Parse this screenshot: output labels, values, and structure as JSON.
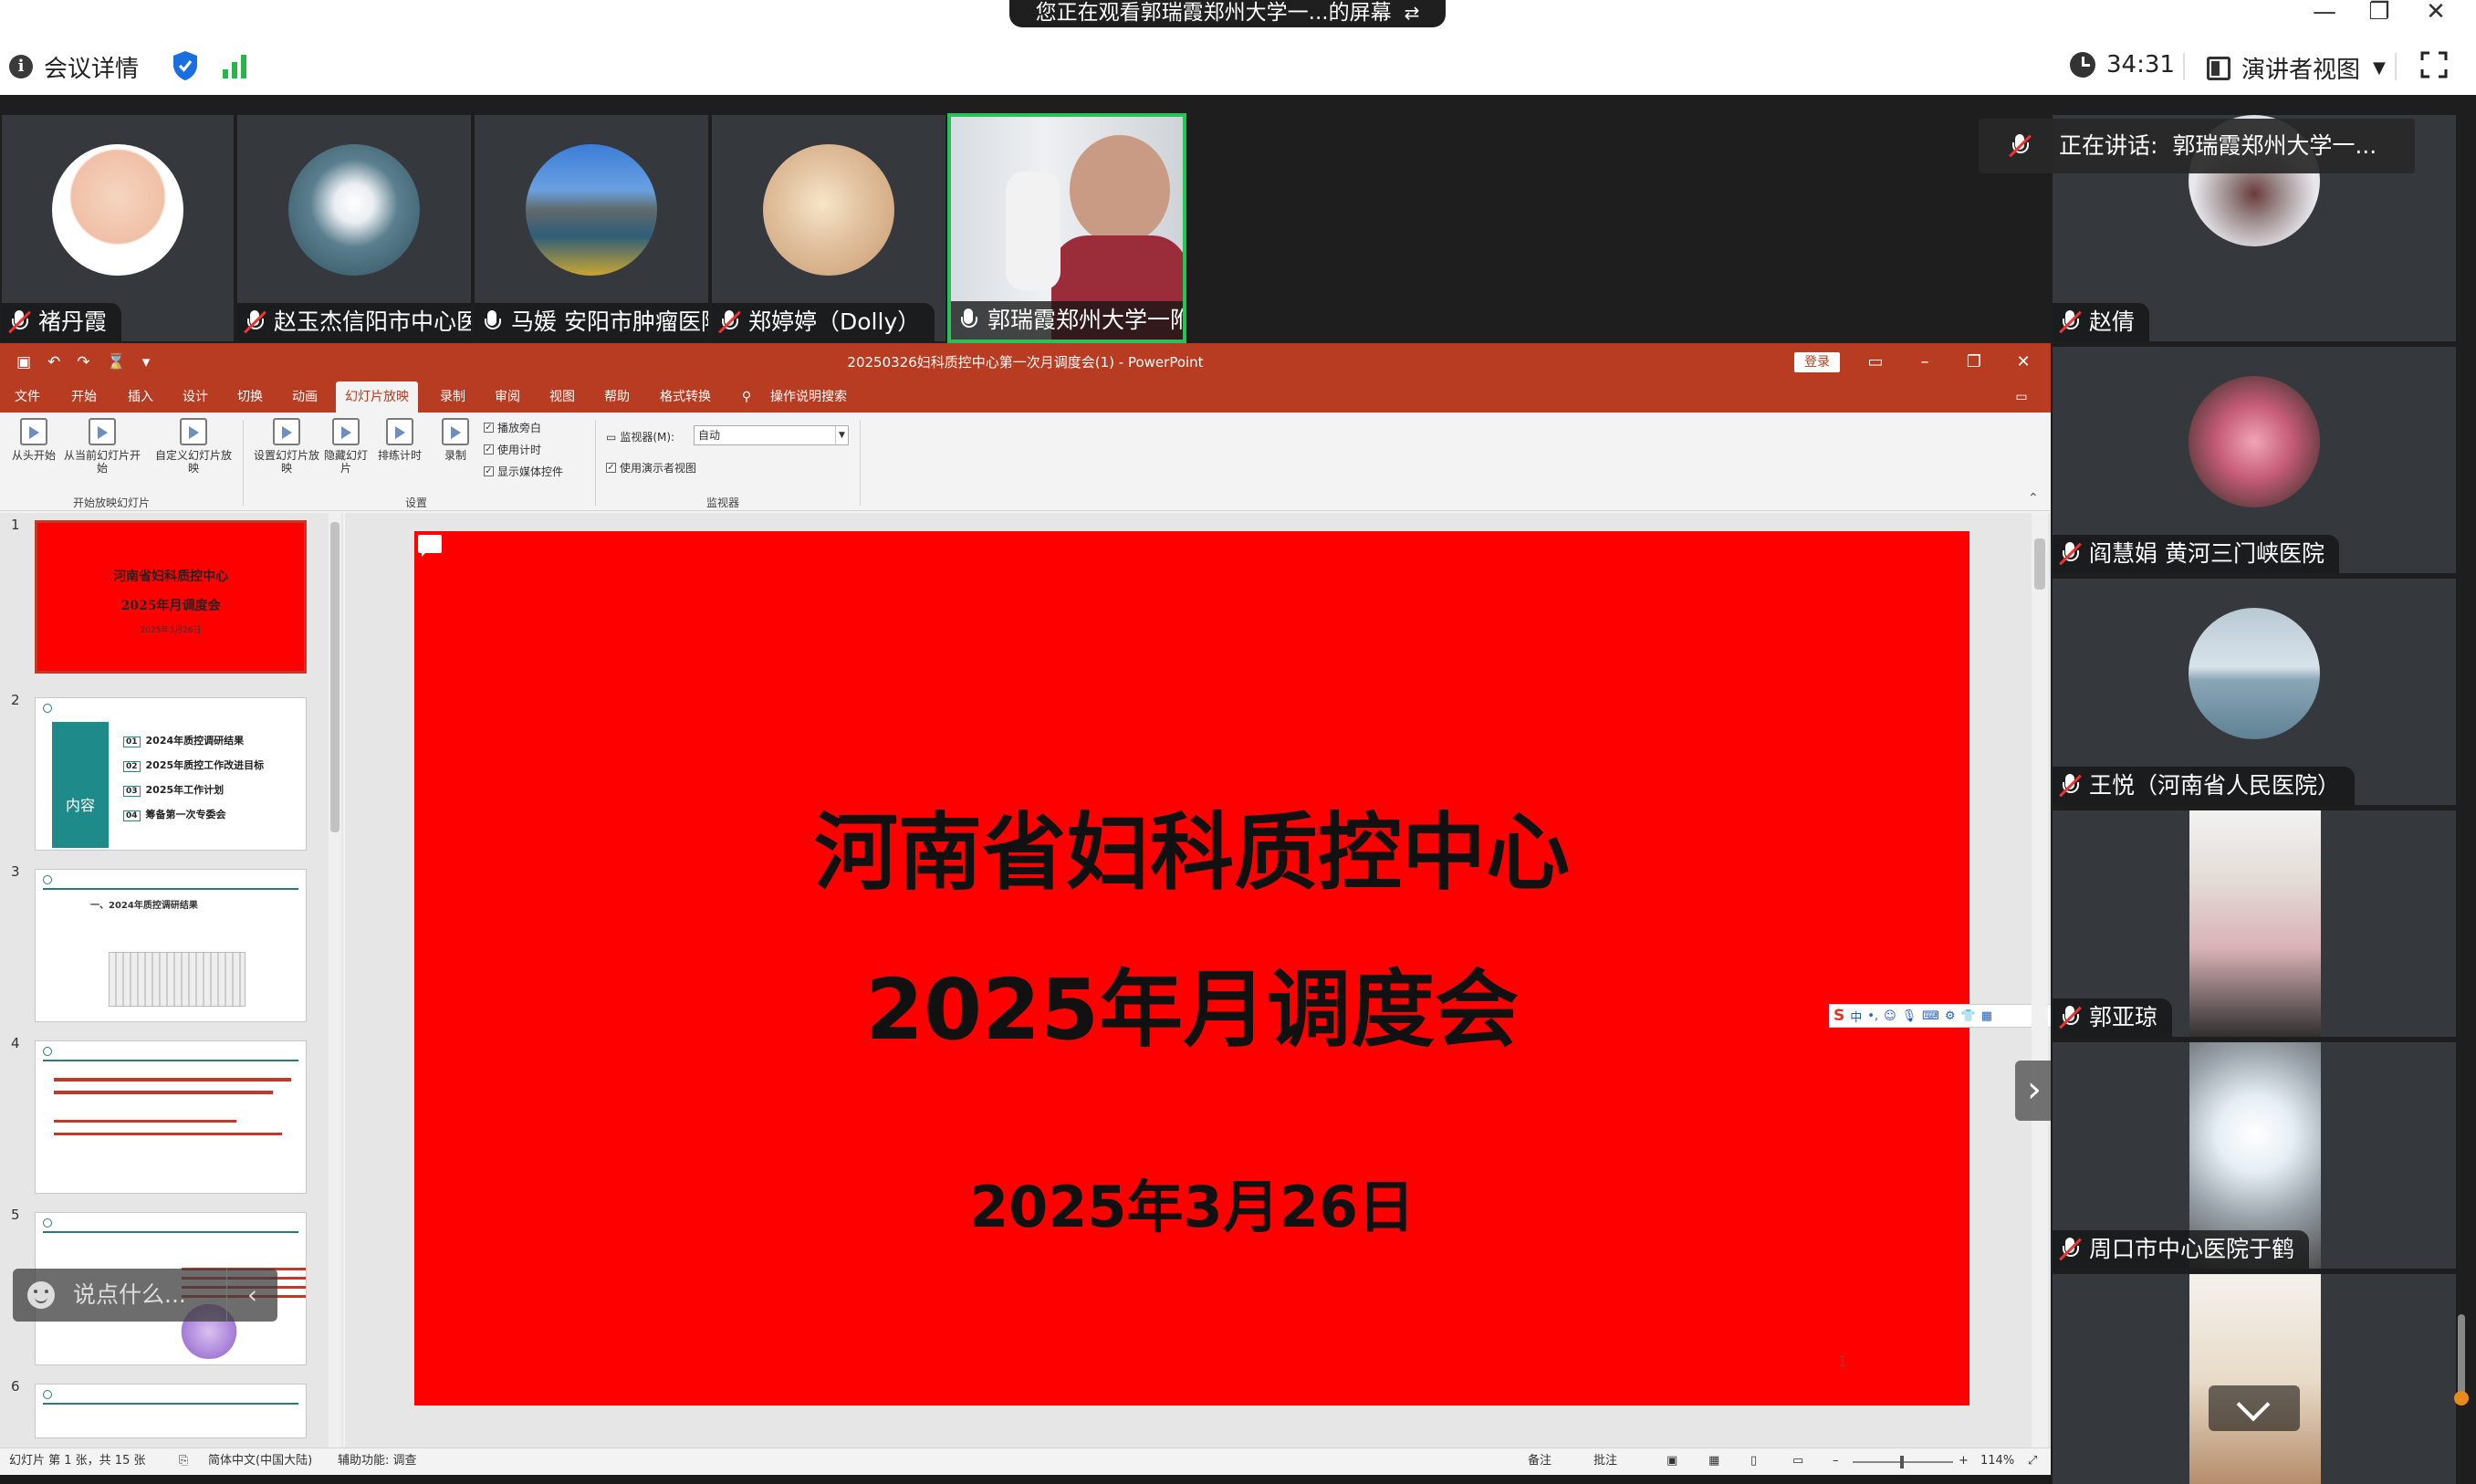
{
  "window": {
    "share_banner": "您正在观看郭瑞霞郑州大学一...的屏幕",
    "meeting_info_label": "会议详情",
    "timer": "34:31",
    "view_mode_label": "演讲者视图"
  },
  "speaking": {
    "label": "正在讲话:",
    "name": "郭瑞霞郑州大学一..."
  },
  "top_participants": [
    {
      "name": "褚丹霞"
    },
    {
      "name": "赵玉杰信阳市中心医院"
    },
    {
      "name": "马媛 安阳市肿瘤医院"
    },
    {
      "name": "郑婷婷（Dolly）"
    },
    {
      "name": "郭瑞霞郑州大学一附院妇科"
    }
  ],
  "right_participants": [
    {
      "name": "赵倩"
    },
    {
      "name": "阎慧娟 黄河三门峡医院"
    },
    {
      "name": "王悦（河南省人民医院）"
    },
    {
      "name": "郭亚琼"
    },
    {
      "name": "周口市中心医院于鹤"
    }
  ],
  "ppt": {
    "title": "20250326妇科质控中心第一次月调度会(1)  -  PowerPoint",
    "login": "登录",
    "menu": [
      "文件",
      "开始",
      "插入",
      "设计",
      "切换",
      "动画",
      "幻灯片放映",
      "录制",
      "审阅",
      "视图",
      "帮助",
      "格式转换",
      "操作说明搜索"
    ],
    "ribbon": {
      "from_start": "从头开始",
      "from_current": "从当前幻灯片开始",
      "custom": "自定义幻灯片放映",
      "group_start": "开始放映幻灯片",
      "setup": "设置幻灯片放映",
      "hide": "隐藏幻灯片",
      "rehearse": "排练计时",
      "record": "录制",
      "play_narration": "播放旁白",
      "use_timing": "使用计时",
      "show_media": "显示媒体控件",
      "group_setup": "设置",
      "monitor_label": "监视器(M):",
      "monitor_value": "自动",
      "presenter_view": "使用演示者视图",
      "group_monitor": "监视器"
    },
    "thumbnails": [
      {
        "num": "1",
        "line1": "河南省妇科质控中心",
        "line2": "2025年月调度会",
        "line3": "2025年3月26日"
      },
      {
        "num": "2",
        "box_label": "内容",
        "items": [
          "2024年质控调研结果",
          "2025年质控工作改进目标",
          "2025年工作计划",
          "筹备第一次专委会"
        ],
        "item_nums": [
          "01",
          "02",
          "03",
          "04"
        ]
      },
      {
        "num": "3",
        "heading": "一、2024年质控调研结果"
      },
      {
        "num": "4"
      },
      {
        "num": "5"
      },
      {
        "num": "6"
      }
    ],
    "slide": {
      "title": "河南省妇科质控中心",
      "subtitle": "2025年月调度会",
      "date": "2025年3月26日",
      "page_number": "1"
    },
    "ime": {
      "lang": "中"
    },
    "status": {
      "slide_info": "幻灯片 第 1 张，共 15 张",
      "language": "简体中文(中国大陆)",
      "accessibility": "辅助功能: 调查",
      "notes": "备注",
      "comments": "批注",
      "zoom": "114%"
    }
  },
  "chat": {
    "placeholder": "说点什么..."
  },
  "colors": {
    "ppt_accent": "#b83c22",
    "slide_bg": "#ff0000",
    "active_speaker": "#29c25a"
  }
}
